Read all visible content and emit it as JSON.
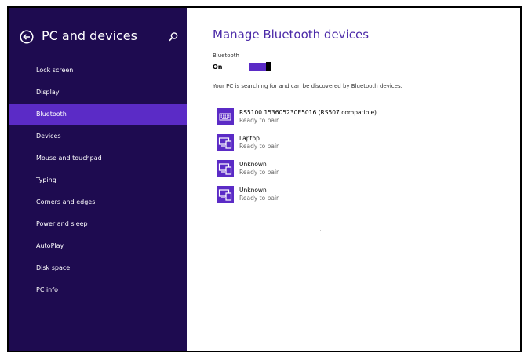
{
  "window": {
    "header_title": "PC and devices"
  },
  "sidebar": {
    "items": [
      {
        "label": "Lock screen",
        "active": false
      },
      {
        "label": "Display",
        "active": false
      },
      {
        "label": "Bluetooth",
        "active": true
      },
      {
        "label": "Devices",
        "active": false
      },
      {
        "label": "Mouse and touchpad",
        "active": false
      },
      {
        "label": "Typing",
        "active": false
      },
      {
        "label": "Corners and edges",
        "active": false
      },
      {
        "label": "Power and sleep",
        "active": false
      },
      {
        "label": "AutoPlay",
        "active": false
      },
      {
        "label": "Disk space",
        "active": false
      },
      {
        "label": "PC info",
        "active": false
      }
    ]
  },
  "main": {
    "title": "Manage Bluetooth devices",
    "bluetooth_label": "Bluetooth",
    "bluetooth_state": "On",
    "status_text": "Your PC is searching for and can be discovered by Bluetooth devices.",
    "devices": [
      {
        "name": "RS5100  153605230E5016  (RS507 compatible)",
        "status": "Ready to pair",
        "icon": "keyboard-icon"
      },
      {
        "name": "Laptop",
        "status": "Ready to pair",
        "icon": "devices-icon"
      },
      {
        "name": "Unknown",
        "status": "Ready to pair",
        "icon": "devices-icon"
      },
      {
        "name": "Unknown",
        "status": "Ready to pair",
        "icon": "devices-icon"
      }
    ]
  },
  "colors": {
    "sidebar_bg": "#1e0b50",
    "accent": "#5b2bc6",
    "title": "#4b2aa8"
  }
}
